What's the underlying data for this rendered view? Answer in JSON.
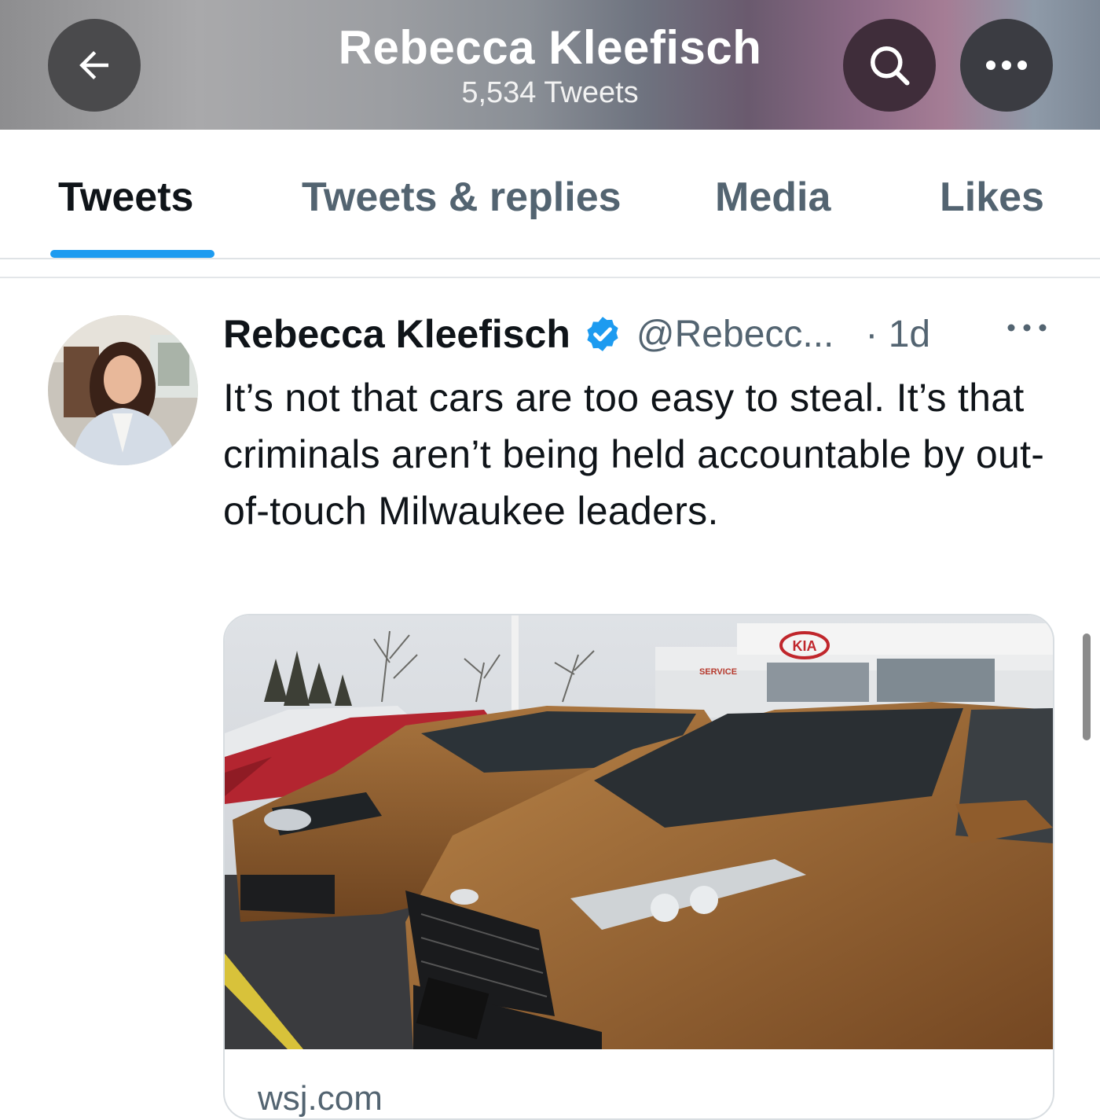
{
  "header": {
    "title": "Rebecca Kleefisch",
    "subtitle": "5,534 Tweets",
    "back_icon": "back-arrow-icon",
    "search_icon": "search-icon",
    "more_icon": "more-horizontal-icon"
  },
  "tabs": [
    {
      "label": "Tweets",
      "active": true
    },
    {
      "label": "Tweets & replies",
      "active": false
    },
    {
      "label": "Media",
      "active": false
    },
    {
      "label": "Likes",
      "active": false
    }
  ],
  "tweet": {
    "author_name": "Rebecca Kleefisch",
    "handle": "@Rebecc...",
    "time": "· 1d",
    "verified": true,
    "text": "It’s not that cars are too easy to steal. It’s that criminals aren’t being held accountable by out-of-touch Milwaukee leaders.",
    "card": {
      "domain": "wsj.com",
      "image_description_icon": "car-dealership-photo",
      "sign_text": "KIA",
      "service_text": "SERVICE"
    }
  },
  "colors": {
    "accent": "#1d9bf0",
    "text_primary": "#0f1419",
    "text_secondary": "#536471"
  }
}
